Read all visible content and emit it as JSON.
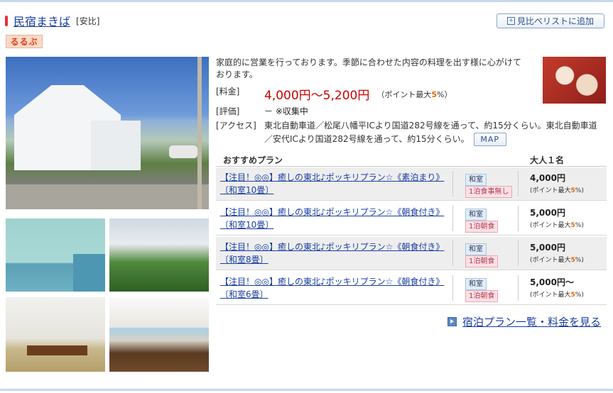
{
  "header": {
    "name": "民宿まきば",
    "area": "[安比]",
    "compare_label": "見比べリストに追加",
    "brand_badge": "るるぶ"
  },
  "description": "家庭的に営業を行っております。季節に合わせた内容の料理を出す様に心がけております。",
  "info": {
    "price_label": "[料金]",
    "price_value": "4,000円〜5,200円",
    "price_point_prefix": "（ポイント最大",
    "price_point_pct": "5",
    "price_point_suffix": "%）",
    "rating_label": "[評価]",
    "rating_value": "－ ※収集中",
    "access_label": "[アクセス]",
    "access_value": "東北自動車道／松尾八幡平ICより国道282号線を通って、約15分くらい。東北自動車道／安代ICより国道282号線を通って、約15分くらい。",
    "map_label": "MAP"
  },
  "plans": {
    "header_plan": "おすすめプラン",
    "header_price": "大人１名",
    "rows": [
      {
        "title": "【注目！◎◎】癒しの東北♪ポッキリプラン☆《素泊まり》〔和室10畳〕",
        "room": "和室",
        "meal": "1泊食事無し",
        "price": "4,000円",
        "point_prefix": "(ポイント最大",
        "point_pct": "5",
        "point_suffix": "%)"
      },
      {
        "title": "【注目！◎◎】癒しの東北♪ポッキリプラン☆《朝食付き》〔和室10畳〕",
        "room": "和室",
        "meal": "1泊朝食",
        "price": "5,000円",
        "point_prefix": "(ポイント最大",
        "point_pct": "5",
        "point_suffix": "%)"
      },
      {
        "title": "【注目！◎◎】癒しの東北♪ポッキリプラン☆《朝食付き》〔和室8畳〕",
        "room": "和室",
        "meal": "1泊朝食",
        "price": "5,000円",
        "point_prefix": "(ポイント最大",
        "point_pct": "5",
        "point_suffix": "%)"
      },
      {
        "title": "【注目！◎◎】癒しの東北♪ポッキリプラン☆《朝食付き》〔和室6畳〕",
        "room": "和室",
        "meal": "1泊朝食",
        "price": "5,000円〜",
        "point_prefix": "(ポイント最大",
        "point_pct": "5",
        "point_suffix": "%)"
      }
    ],
    "list_link": "宿泊プラン一覧・料金を見る"
  },
  "colors": {
    "accent_link": "#1a3ea3",
    "price_red": "#cc0000",
    "point_orange": "#e46c00"
  }
}
